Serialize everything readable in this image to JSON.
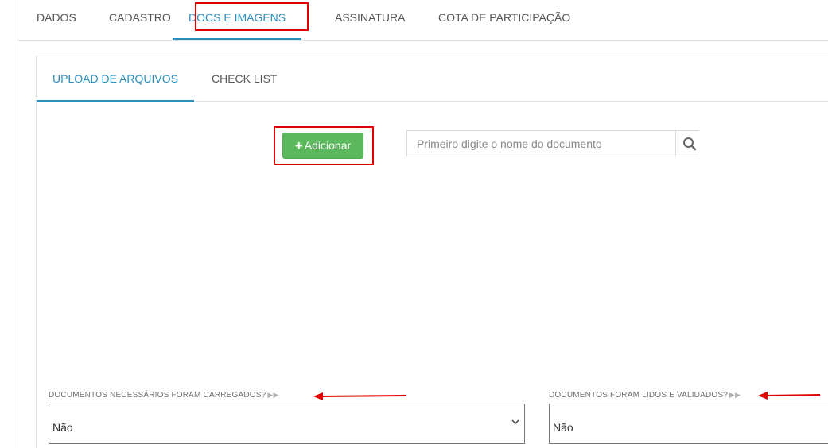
{
  "top_tabs": [
    {
      "label": "DADOS"
    },
    {
      "label": "CADASTRO"
    },
    {
      "label": "DOCS E IMAGENS",
      "active": true
    },
    {
      "label": "ASSINATURA"
    },
    {
      "label": "COTA DE PARTICIPAÇÃO"
    }
  ],
  "sub_tabs": [
    {
      "label": "UPLOAD DE ARQUIVOS",
      "active": true
    },
    {
      "label": "CHECK LIST"
    }
  ],
  "toolbar": {
    "add_label": "Adicionar",
    "add_icon": "plus-icon",
    "add_color": "#5cb85c"
  },
  "search": {
    "placeholder": "Primeiro digite o nome do documento",
    "icon": "search-icon"
  },
  "questions": [
    {
      "label": "DOCUMENTOS NECESSÁRIOS FORAM CARREGADOS?",
      "value": "Não"
    },
    {
      "label": "DOCUMENTOS FORAM LIDOS E VALIDADOS?",
      "value": "Não"
    }
  ],
  "colors": {
    "accent": "#2a8fbd",
    "highlight": "#e00000"
  }
}
